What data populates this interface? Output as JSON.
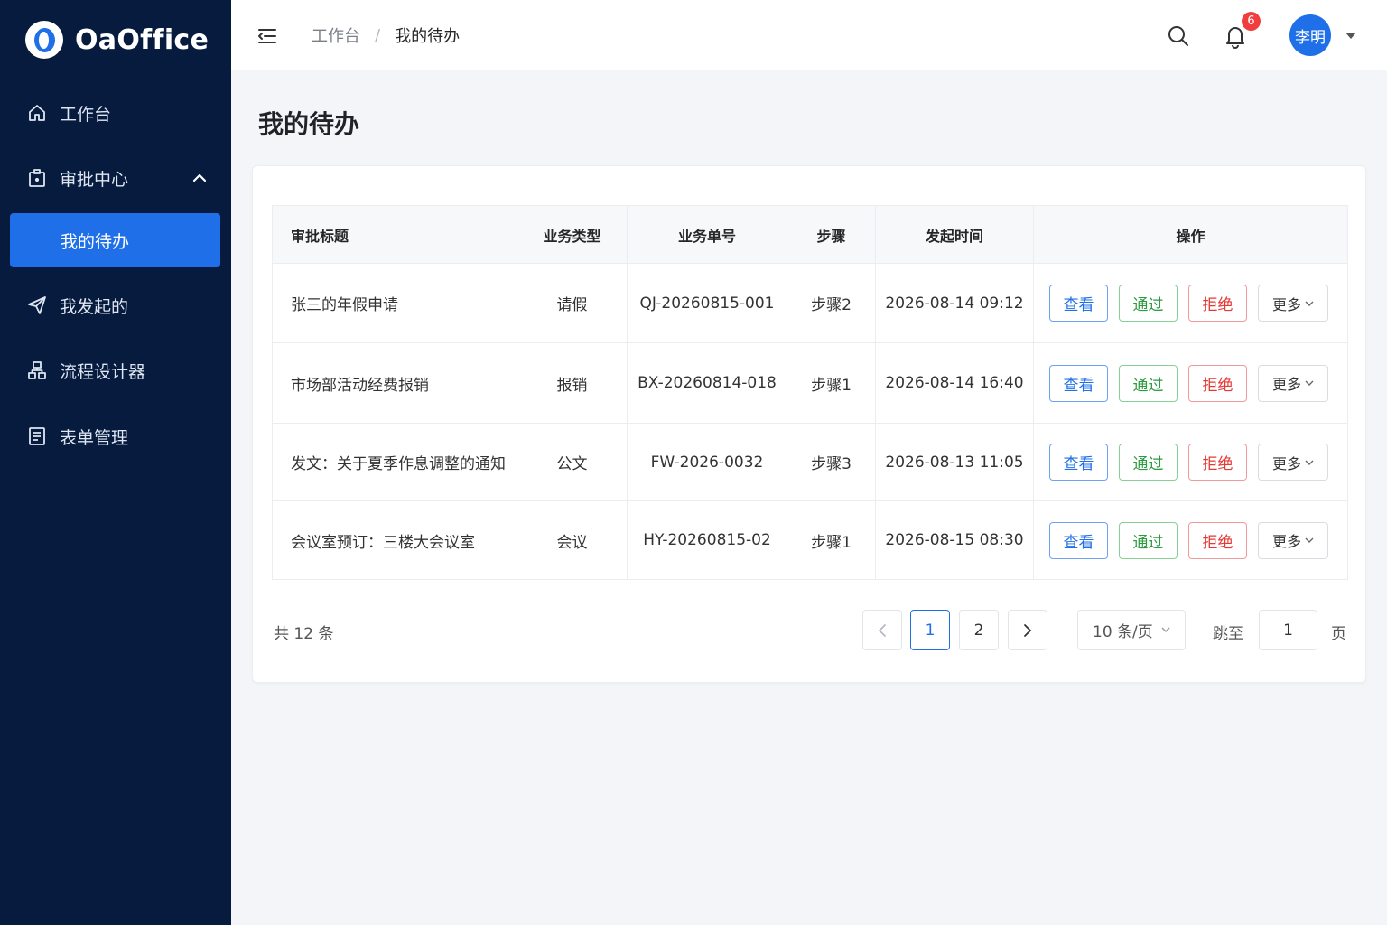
{
  "app": {
    "name": "OaOffice"
  },
  "sidebar": {
    "items": [
      {
        "label": "工作台"
      },
      {
        "label": "审批中心"
      },
      {
        "label": "我的待办"
      },
      {
        "label": "我发起的"
      },
      {
        "label": "流程设计器"
      },
      {
        "label": "表单管理"
      }
    ]
  },
  "header": {
    "breadcrumb": {
      "home": "工作台",
      "separator": "/",
      "current": "我的待办"
    },
    "notification_count": "6",
    "user": "李明"
  },
  "main": {
    "title": "我的待办",
    "table": {
      "columns": [
        "审批标题",
        "业务类型",
        "业务单号",
        "步骤",
        "发起时间",
        "操作"
      ],
      "rows": [
        {
          "title": "张三的年假申请",
          "type": "请假",
          "number": "QJ-20260815-001",
          "step": "步骤2",
          "time": "2026-08-14 09:12"
        },
        {
          "title": "市场部活动经费报销",
          "type": "报销",
          "number": "BX-20260814-018",
          "step": "步骤1",
          "time": "2026-08-14 16:40"
        },
        {
          "title": "发文：关于夏季作息调整的通知",
          "type": "公文",
          "number": "FW-2026-0032",
          "step": "步骤3",
          "time": "2026-08-13 11:05"
        },
        {
          "title": "会议室预订：三楼大会议室",
          "type": "会议",
          "number": "HY-20260815-02",
          "step": "步骤1",
          "time": "2026-08-15 08:30"
        }
      ],
      "actions": {
        "view": "查看",
        "pass": "通过",
        "reject": "拒绝",
        "more": "更多"
      }
    },
    "pagination": {
      "total_text": "共 12 条",
      "pages": [
        "1",
        "2"
      ],
      "current_page": "1",
      "page_size": "10 条/页",
      "jump_label": "跳至",
      "jump_value": "1",
      "page_unit": "页"
    }
  },
  "colors": {
    "sidebar_bg": "#061b3e",
    "primary": "#1f6fe8",
    "success": "#2a9b3f",
    "danger": "#e53935",
    "badge": "#f03e3e"
  }
}
